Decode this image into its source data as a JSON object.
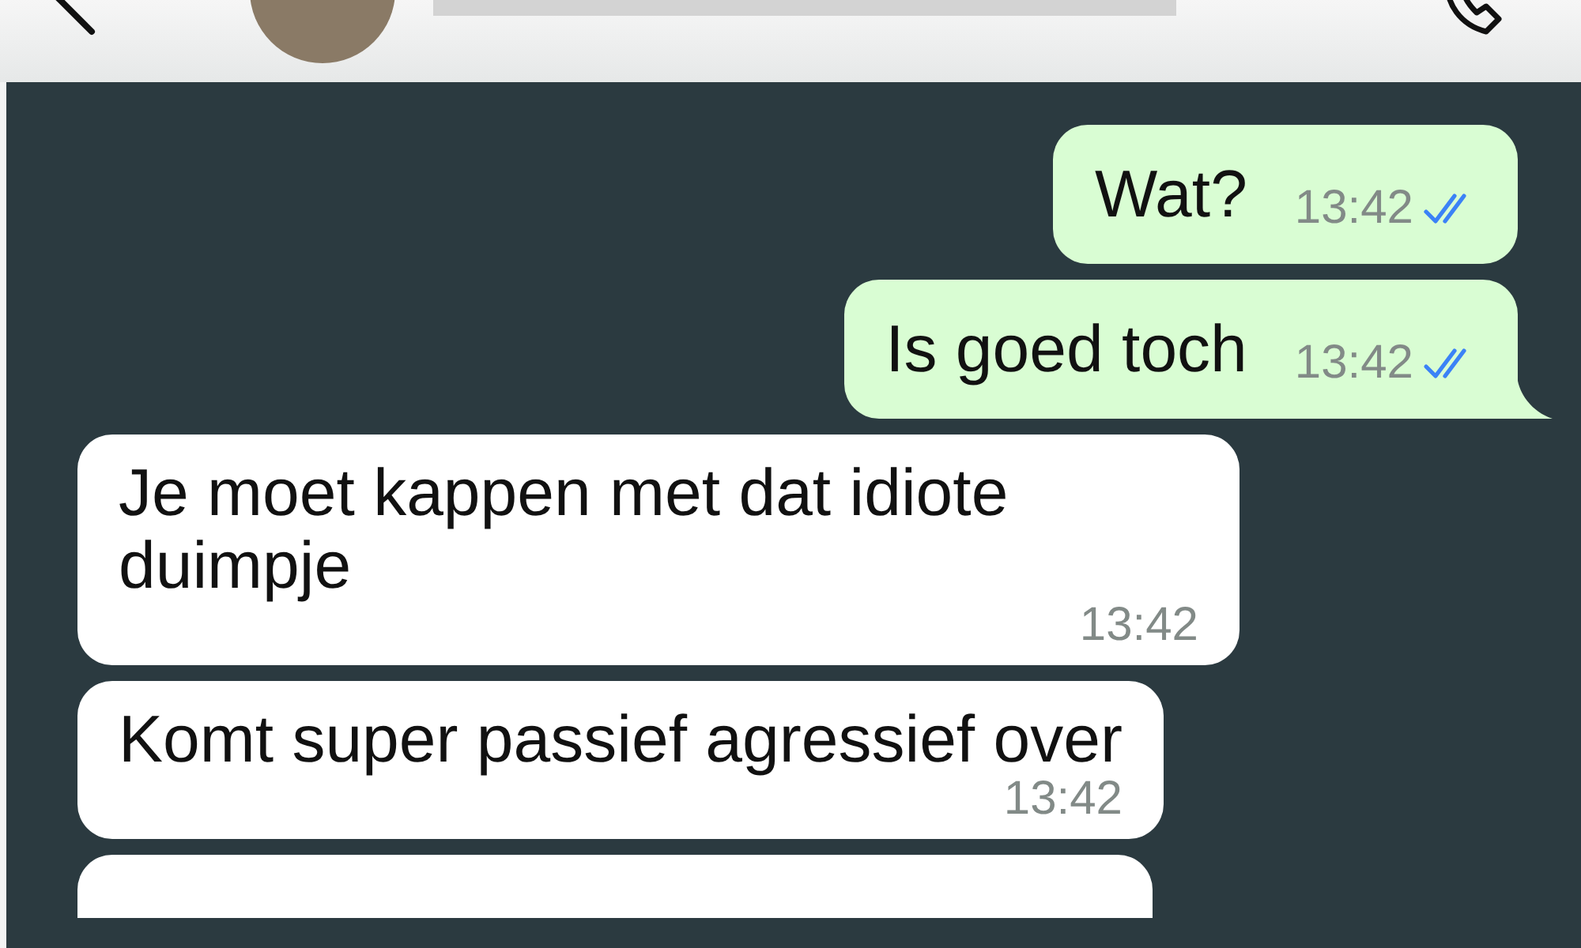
{
  "messages": [
    {
      "kind": "out",
      "text": "Wat?",
      "time": "13:42",
      "read": true,
      "tail": false
    },
    {
      "kind": "out",
      "text": "Is goed toch",
      "time": "13:42",
      "read": true,
      "tail": true
    },
    {
      "kind": "in",
      "text": "Je moet kappen met dat idiote duimpje",
      "time": "13:42"
    },
    {
      "kind": "in",
      "text": "Komt super passief agressief over",
      "time": "13:42"
    }
  ]
}
